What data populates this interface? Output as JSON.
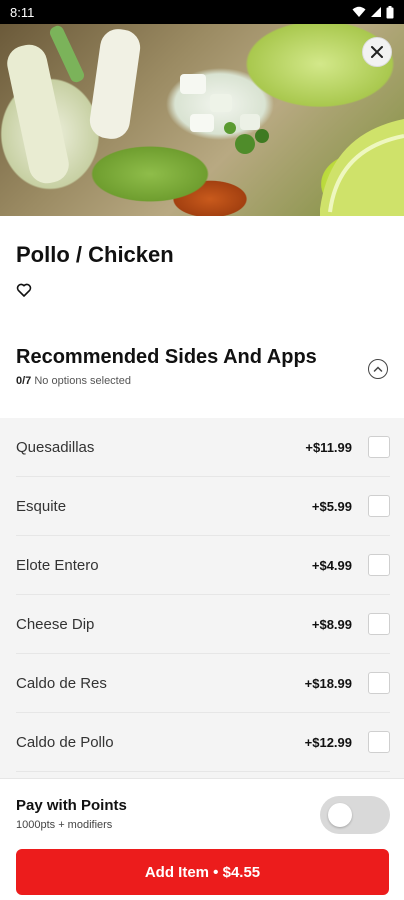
{
  "status_bar": {
    "time": "8:11",
    "icons": [
      "wifi-icon",
      "signal-icon",
      "battery-icon"
    ]
  },
  "hero": {
    "image": "tacos-photo",
    "close_icon": "close-icon"
  },
  "item": {
    "title": "Pollo / Chicken",
    "favorite_icon": "heart-outline-icon"
  },
  "section": {
    "title": "Recommended Sides And Apps",
    "selected_count": "0/7",
    "selected_text": "No options selected",
    "collapse_icon": "chevron-up-icon"
  },
  "options": [
    {
      "name": "Quesadillas",
      "price": "+$11.99",
      "checked": false
    },
    {
      "name": "Esquite",
      "price": "+$5.99",
      "checked": false
    },
    {
      "name": "Elote Entero",
      "price": "+$4.99",
      "checked": false
    },
    {
      "name": "Cheese Dip",
      "price": "+$8.99",
      "checked": false
    },
    {
      "name": "Caldo de Res",
      "price": "+$18.99",
      "checked": false
    },
    {
      "name": "Caldo de Pollo",
      "price": "+$12.99",
      "checked": false
    }
  ],
  "points": {
    "title": "Pay with Points",
    "subtitle": "1000pts + modifiers",
    "enabled": false
  },
  "cta": {
    "label": "Add Item • $4.55",
    "color": "#ec1c1c"
  }
}
